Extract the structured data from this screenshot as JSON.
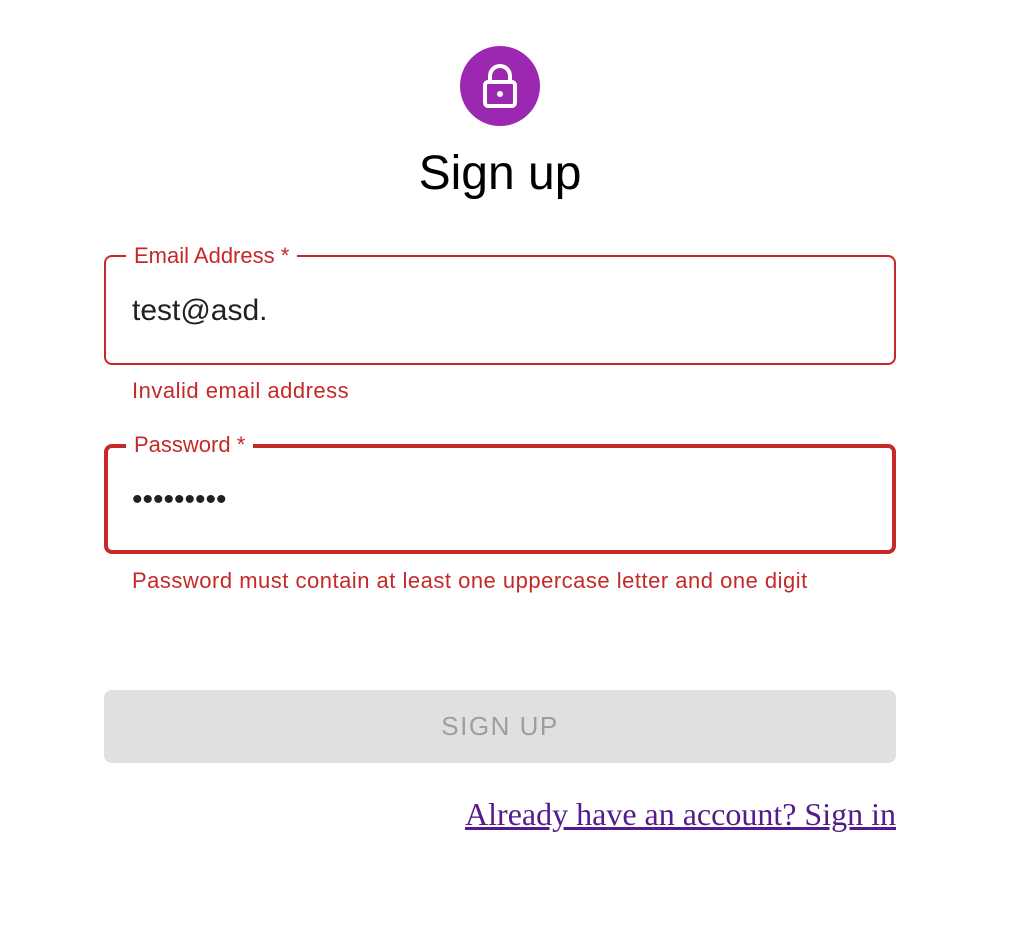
{
  "form": {
    "icon": "lock-icon",
    "title": "Sign up",
    "accent_color": "#9c27b0",
    "error_color": "#c62828",
    "email": {
      "label": "Email Address *",
      "value": "test@asd.",
      "error": "Invalid email address"
    },
    "password": {
      "label": "Password *",
      "value": "•••••••••",
      "error": "Password must contain at least one uppercase letter and one digit"
    },
    "submit_label": "SIGN UP",
    "signin_link": "Already have an account? Sign in"
  }
}
